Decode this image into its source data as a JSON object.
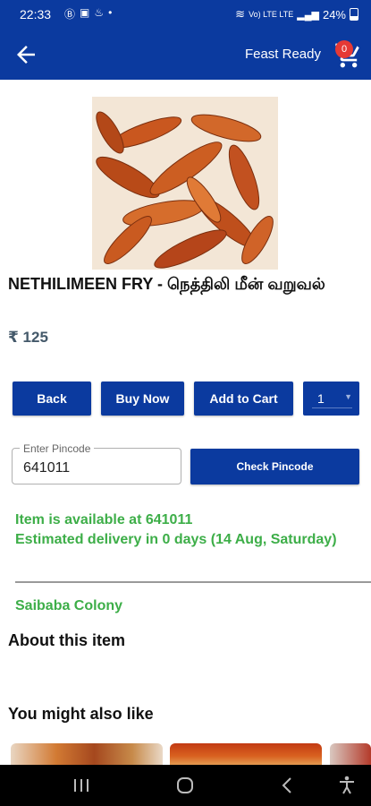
{
  "status_bar": {
    "time": "22:33",
    "notification_icons": [
      "b-circle-icon",
      "image-icon",
      "flame-icon",
      "dot-icon"
    ],
    "network": "Vo) LTE LTE",
    "battery": "24%"
  },
  "app_bar": {
    "title": "Feast Ready",
    "cart_count": "0"
  },
  "product": {
    "name": "NETHILIMEEN FRY - நெத்திலி மீன் வறுவல்",
    "price": "₹ 125"
  },
  "actions": {
    "back_label": "Back",
    "buy_now_label": "Buy Now",
    "add_to_cart_label": "Add to Cart",
    "quantity": "1"
  },
  "pincode": {
    "label": "Enter Pincode",
    "value": "641011",
    "check_label": "Check Pincode"
  },
  "availability": {
    "line1": "Item is available at 641011",
    "line2": "Estimated delivery in 0 days (14 Aug, Saturday)"
  },
  "area": "Saibaba Colony",
  "sections": {
    "about": "About this item",
    "also_like": "You might also like"
  },
  "colors": {
    "brand_blue": "#0b3a9f",
    "success_green": "#3dae48",
    "price_grey": "#44596a",
    "badge_red": "#e53935"
  }
}
